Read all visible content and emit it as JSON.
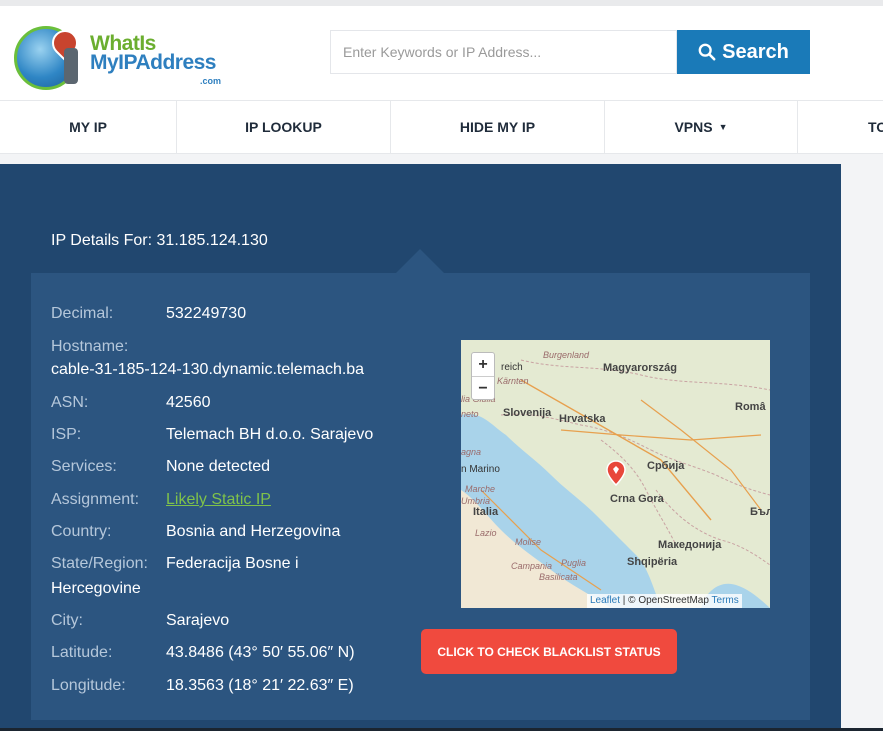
{
  "site": {
    "logo_line1": "WhatIs",
    "logo_line2": "MyIPAddress",
    "logo_line3": ".com"
  },
  "search": {
    "placeholder": "Enter Keywords or IP Address...",
    "button_label": "Search",
    "button_color": "#1a7ab8"
  },
  "nav": {
    "items": [
      {
        "label": "MY IP"
      },
      {
        "label": "IP LOOKUP"
      },
      {
        "label": "HIDE MY IP"
      },
      {
        "label": "VPNS"
      },
      {
        "label": "TO"
      }
    ]
  },
  "details": {
    "heading": "IP Details For: 31.185.124.130",
    "decimal_label": "Decimal:",
    "decimal_value": "532249730",
    "hostname_label": "Hostname:",
    "hostname_value": "cable-31-185-124-130.dynamic.telemach.ba",
    "asn_label": "ASN:",
    "asn_value": "42560",
    "isp_label": "ISP:",
    "isp_value": "Telemach BH d.o.o. Sarajevo",
    "services_label": "Services:",
    "services_value": "None detected",
    "assignment_label": "Assignment:",
    "assignment_value": "Likely Static IP",
    "country_label": "Country:",
    "country_value": "Bosnia and Herzegovina",
    "state_label": "State/Region:",
    "state_value_line1": "Federacija Bosne i",
    "state_value_line2": "Hercegovine",
    "city_label": "City:",
    "city_value": "Sarajevo",
    "latitude_label": "Latitude:",
    "latitude_value": "43.8486 (43° 50′ 55.06″ N)",
    "longitude_label": "Longitude:",
    "longitude_value": "18.3563 (18° 21′ 22.63″ E)"
  },
  "map": {
    "zoom_in": "+",
    "zoom_out": "−",
    "labels": {
      "burgenland": "Burgenland",
      "reich": "reich",
      "karnten": "Kärnten",
      "magyarorszag": "Magyarország",
      "giulia": "lia Giulia",
      "slovenija": "Slovenija",
      "hrvatska": "Hrvatska",
      "veneto": "neto",
      "romania": "Româ",
      "magna": "agna",
      "san_marino": "n Marino",
      "marche": "Marche",
      "umbria": "Umbria",
      "srbija": "Србија",
      "italia": "Italia",
      "crna_gora": "Crna Gora",
      "lazio": "Lazio",
      "bulgaria": "Бъл",
      "molise": "Molise",
      "makedonija": "Македонија",
      "campania": "Campania",
      "puglia": "Puglia",
      "shqiperia": "Shqipëria",
      "basilicata": "Basilicata"
    },
    "attribution_leaflet": "Leaflet",
    "attribution_sep": " | © OpenStreetMap ",
    "attribution_terms": "Terms"
  },
  "blacklist_button": "CLICK TO CHECK BLACKLIST STATUS",
  "colors": {
    "panel": "#21476f",
    "card": "#2c5580",
    "link_green": "#7fc24a",
    "blacklist_red": "#f04a3e"
  }
}
